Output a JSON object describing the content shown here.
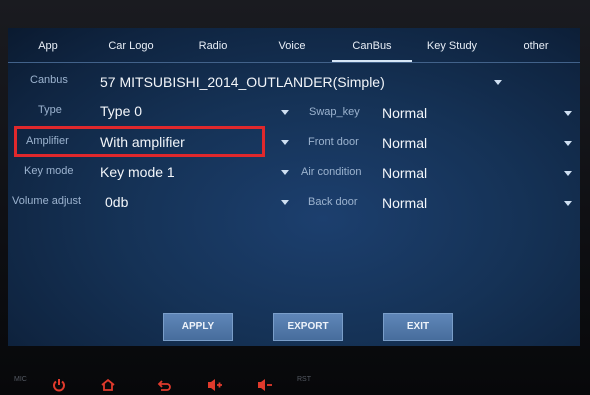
{
  "tabs": [
    {
      "label": "App",
      "active": false
    },
    {
      "label": "Car Logo",
      "active": false
    },
    {
      "label": "Radio",
      "active": false
    },
    {
      "label": "Voice",
      "active": false
    },
    {
      "label": "CanBus",
      "active": true
    },
    {
      "label": "Key Study",
      "active": false
    },
    {
      "label": "other",
      "active": false
    }
  ],
  "settings": {
    "canbus": {
      "label": "Canbus",
      "value": "57 MITSUBISHI_2014_OUTLANDER(Simple)"
    },
    "type": {
      "label": "Type",
      "value": "Type 0"
    },
    "amplifier": {
      "label": "Amplifier",
      "value": "With amplifier"
    },
    "key_mode": {
      "label": "Key mode",
      "value": "Key mode 1"
    },
    "volume_adjust": {
      "label": "Volume adjust",
      "value": "0db"
    },
    "swap_key": {
      "label": "Swap_key",
      "value": "Normal"
    },
    "front_door": {
      "label": "Front door",
      "value": "Normal"
    },
    "air_condition": {
      "label": "Air condition",
      "value": "Normal"
    },
    "back_door": {
      "label": "Back door",
      "value": "Normal"
    }
  },
  "buttons": {
    "apply": "APPLY",
    "export": "EXPORT",
    "exit": "EXIT"
  },
  "hardware": {
    "mic": "MIC",
    "rst": "RST"
  },
  "colors": {
    "highlight": "#e0282c",
    "hardware_icons": "#e03a2c",
    "button": "#5a82b4"
  }
}
